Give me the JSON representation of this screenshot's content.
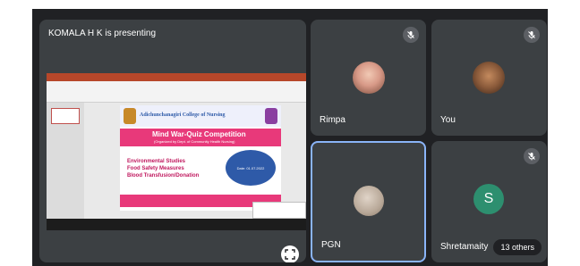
{
  "presenter": {
    "title": "KOMALA H K is presenting",
    "slide": {
      "institution": "Adichunchanagiri College of Nursing",
      "competition": "Mind War-Quiz Competition",
      "organized_by": "(Organized by Dept. of Community Health Nursing)",
      "topics": [
        "Environmental Studies",
        "Food Safety Measures",
        "Blood Transfusion/Donation"
      ],
      "date_block": "Date: 01.07.2022"
    }
  },
  "participants": [
    {
      "name": "Rimpa",
      "muted": true,
      "avatar": "photo",
      "highlighted": false
    },
    {
      "name": "You",
      "muted": true,
      "avatar": "photo",
      "highlighted": false
    },
    {
      "name": "PGN",
      "muted": false,
      "avatar": "photo",
      "highlighted": true
    },
    {
      "name": "Shretamaity",
      "muted": true,
      "avatar": "initial",
      "initial": "S",
      "avatar_color": "#2d8f6f",
      "highlighted": false
    }
  ],
  "others_count_label": "13 others",
  "colors": {
    "meet_bg": "#202124",
    "tile_bg": "#3c4043",
    "active_border": "#8ab4f8",
    "slide_magenta": "#e8397a",
    "slide_blue": "#2e5aa8"
  },
  "icons": {
    "mute": "mic-off-icon",
    "fullscreen": "fullscreen-icon"
  }
}
